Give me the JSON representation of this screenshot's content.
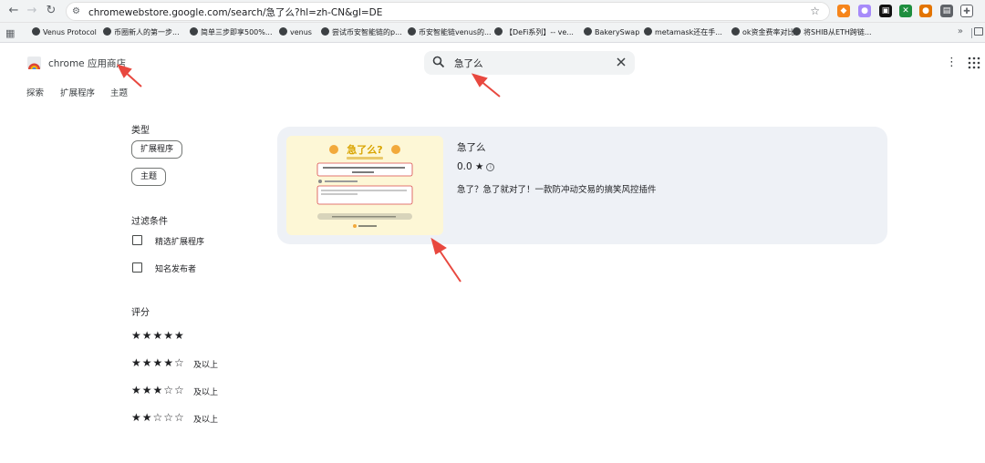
{
  "browser": {
    "url": "chromewebstore.google.com/search/急了么?hl=zh-CN&gl=DE",
    "nav_back": "←",
    "nav_forward": "→",
    "nav_reload": "↻"
  },
  "bookmarks": [
    {
      "label": "Venus Protocol"
    },
    {
      "label": "币圈新人的第一步..."
    },
    {
      "label": "简单三步即享500%..."
    },
    {
      "label": "venus"
    },
    {
      "label": "尝试币安智能链的p..."
    },
    {
      "label": "币安智能链venus的..."
    },
    {
      "label": "【DeFi系列】-- ve..."
    },
    {
      "label": "BakerySwap"
    },
    {
      "label": "metamask还在手..."
    },
    {
      "label": "ok资金费率对比"
    },
    {
      "label": "将SHIB从ETH跨链..."
    }
  ],
  "store": {
    "name": "chrome 应用商店",
    "search_query": "急了么",
    "tabs": [
      {
        "label": "探索"
      },
      {
        "label": "扩展程序"
      },
      {
        "label": "主题"
      }
    ]
  },
  "filters": {
    "type_title": "类型",
    "type_chips": [
      {
        "label": "扩展程序"
      },
      {
        "label": "主题"
      }
    ],
    "conditions_title": "过滤条件",
    "conditions": [
      {
        "label": "精选扩展程序",
        "checked": false
      },
      {
        "label": "知名发布者",
        "checked": false
      }
    ],
    "rating_title": "评分",
    "ratings": [
      {
        "stars": "★★★★★",
        "label": ""
      },
      {
        "stars": "★★★★☆",
        "label": "及以上"
      },
      {
        "stars": "★★★☆☆",
        "label": "及以上"
      },
      {
        "stars": "★★☆☆☆",
        "label": "及以上"
      }
    ]
  },
  "result": {
    "title": "急了么",
    "rating": "0.0 ★",
    "description": "急了？急了就对了！一款防冲动交易的搞笑风控插件",
    "thumb_heading": "急了么?"
  },
  "colors": {
    "toolbar_bg": "#f1f3f4",
    "card_bg": "#eef1f6",
    "annotation_arrow": "#e8483f",
    "thumb_bg": "#fdf7d6"
  }
}
